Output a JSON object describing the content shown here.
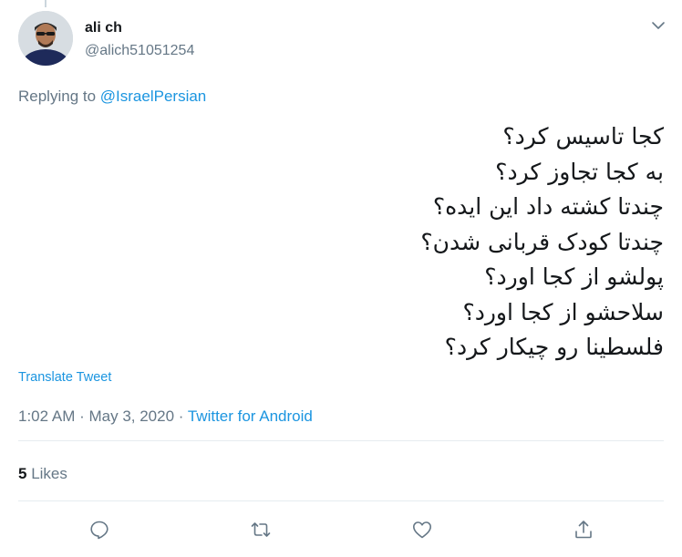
{
  "author": {
    "display_name": "ali ch",
    "handle": "@alich51051254"
  },
  "reply": {
    "prefix": "Replying to ",
    "target": "@IsraelPersian"
  },
  "tweet": {
    "lines": [
      "کجا تاسیس کرد؟",
      "به کجا تجاوز کرد؟",
      "چندتا کشته داد این ایده؟",
      "چندتا کودک قربانی شدن؟",
      "پولشو از کجا اورد؟",
      "سلاحشو از کجا اورد؟",
      "فلسطینا رو چیکار کرد؟"
    ],
    "translate_label": "Translate Tweet"
  },
  "meta": {
    "time_date": "1:02 AM · May 3, 2020 · ",
    "source": "Twitter for Android"
  },
  "stats": {
    "likes_count": "5",
    "likes_label": " Likes"
  },
  "icons": {
    "reply": "reply-icon",
    "retweet": "retweet-icon",
    "like": "heart-icon",
    "share": "share-icon",
    "more": "chevron-down-icon"
  },
  "colors": {
    "link": "#1b95e0",
    "muted": "#657786",
    "text": "#14171a",
    "divider": "#e6ecf0"
  }
}
